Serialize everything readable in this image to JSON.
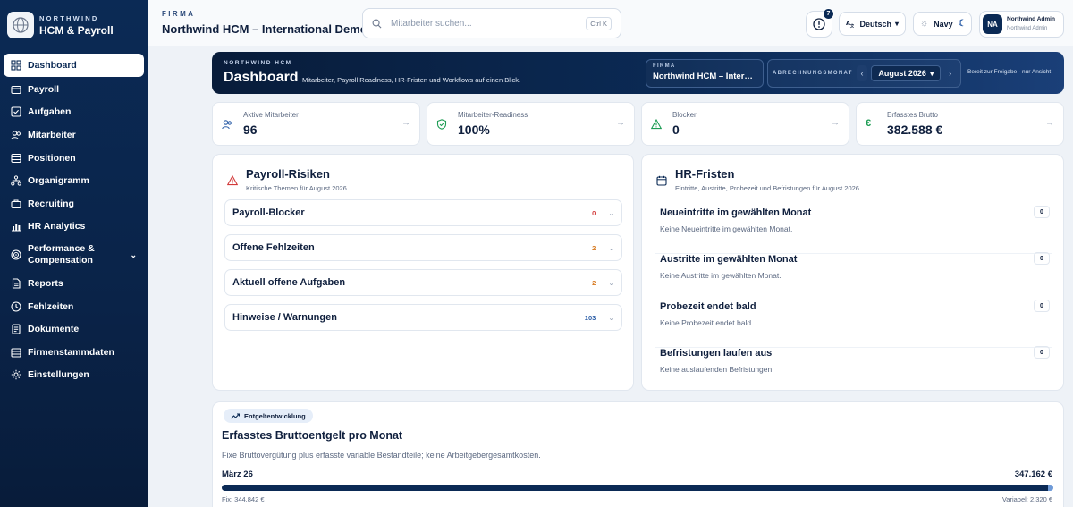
{
  "brand": {
    "sup": "NORTHWIND",
    "name": "HCM & Payroll",
    "logo_icon": "globe-icon"
  },
  "sidebar": {
    "items": [
      {
        "label": "Dashboard",
        "icon": "grid-icon",
        "active": true
      },
      {
        "label": "Payroll",
        "icon": "wallet-icon"
      },
      {
        "label": "Aufgaben",
        "icon": "checkbox-icon"
      },
      {
        "label": "Mitarbeiter",
        "icon": "users-icon"
      },
      {
        "label": "Positionen",
        "icon": "table-icon"
      },
      {
        "label": "Organigramm",
        "icon": "org-icon"
      },
      {
        "label": "Recruiting",
        "icon": "briefcase-icon"
      },
      {
        "label": "HR Analytics",
        "icon": "chart-icon"
      },
      {
        "label": "Performance &",
        "label2": "Compensation",
        "icon": "target-icon"
      },
      {
        "label": "Reports",
        "icon": "file-icon"
      },
      {
        "label": "Fehlzeiten",
        "icon": "clock-icon"
      },
      {
        "label": "Dokumente",
        "icon": "document-icon"
      },
      {
        "label": "Firmenstammdaten",
        "icon": "building-icon"
      },
      {
        "label": "Einstellungen",
        "icon": "gear-icon"
      }
    ]
  },
  "topbar": {
    "firma_label": "FIRMA",
    "firma_name": "Northwind HCM – International Demo",
    "search_placeholder": "Mitarbeiter suchen...",
    "search_shortcut": "Ctrl K",
    "alert_count": "7",
    "language": "Deutsch",
    "theme": "Navy",
    "user_initials": "NA",
    "user_name": "Northwind Admin",
    "user_sub": "Northwind Admin"
  },
  "hero": {
    "sup": "NORTHWIND HCM",
    "title": "Dashboard",
    "desc": "Mitarbeiter, Payroll Readiness, HR-Fristen und Workflows auf einen Blick.",
    "firma_label": "FIRMA",
    "firma_value": "Northwind HCM – International Demo",
    "month_label": "ABRECHNUNGSMONAT",
    "month_value": "August 2026",
    "status": "Bereit zur Freigabe · nur Ansicht"
  },
  "kpis": [
    {
      "label": "Aktive Mitarbeiter",
      "value": "96",
      "icon": "users-icon",
      "color": "#2d5fa8"
    },
    {
      "label": "Mitarbeiter-Readiness",
      "value": "100%",
      "icon": "shield-check-icon",
      "color": "#1f9d55"
    },
    {
      "label": "Blocker",
      "value": "0",
      "icon": "warning-icon",
      "color": "#1f9d55"
    },
    {
      "label": "Erfasstes Brutto",
      "value": "382.588 €",
      "icon": "euro-icon",
      "color": "#1f9d55"
    }
  ],
  "risks": {
    "title": "Payroll-Risiken",
    "subtitle": "Kritische Themen für August 2026.",
    "items": [
      {
        "label": "Payroll-Blocker",
        "count": "0",
        "tone": "red"
      },
      {
        "label": "Offene Fehlzeiten",
        "count": "2",
        "tone": "org"
      },
      {
        "label": "Aktuell offene Aufgaben",
        "count": "2",
        "tone": "org"
      },
      {
        "label": "Hinweise / Warnungen",
        "count": "103",
        "tone": "blue"
      }
    ]
  },
  "fristen": {
    "title": "HR-Fristen",
    "subtitle": "Eintritte, Austritte, Probezeit und Befristungen für August 2026.",
    "items": [
      {
        "title": "Neueintritte im gewählten Monat",
        "sub": "Keine Neueintritte im gewählten Monat.",
        "count": "0"
      },
      {
        "title": "Austritte im gewählten Monat",
        "sub": "Keine Austritte im gewählten Monat.",
        "count": "0"
      },
      {
        "title": "Probezeit endet bald",
        "sub": "Keine Probezeit endet bald.",
        "count": "0"
      },
      {
        "title": "Befristungen laufen aus",
        "sub": "Keine auslaufenden Befristungen.",
        "count": "0"
      }
    ]
  },
  "entgelt": {
    "pill": "Entgeltentwicklung",
    "title": "Erfasstes Bruttoentgelt pro Monat",
    "subtitle": "Fixe Bruttovergütung plus erfasste variable Bestandteile; keine Arbeitgebergesamtkosten.",
    "month": "März 26",
    "total": "347.162 €",
    "fix_label": "Fix: 344.842 €",
    "var_label": "Variabel: 2.320 €",
    "fix_value": 344842,
    "var_value": 2320,
    "max_value": 347162
  }
}
